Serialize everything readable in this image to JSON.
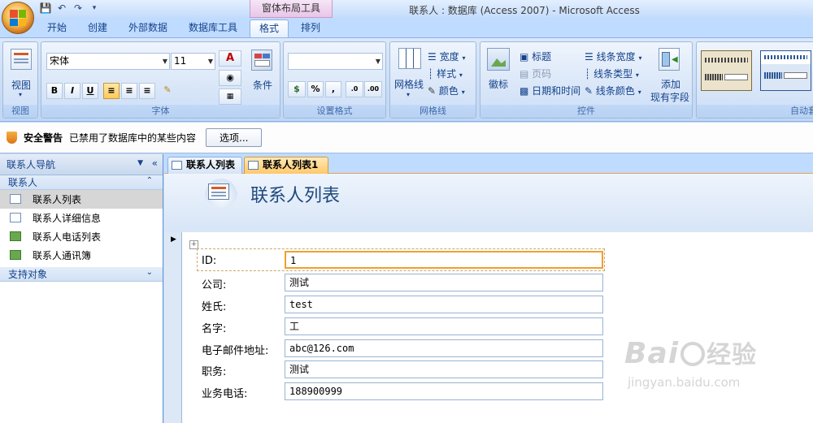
{
  "window": {
    "title": "联系人 : 数据库 (Access 2007) - Microsoft Access",
    "context_tools": "窗体布局工具"
  },
  "tabs": [
    "开始",
    "创建",
    "外部数据",
    "数据库工具",
    "格式",
    "排列"
  ],
  "ribbon": {
    "view": {
      "label": "视图",
      "group": "视图"
    },
    "font": {
      "family": "宋体",
      "size": "11",
      "conditions": "条件",
      "group": "字体"
    },
    "format": {
      "group": "设置格式"
    },
    "gridlines": {
      "label": "网格线",
      "width": "宽度",
      "style": "样式",
      "color": "颜色",
      "group": "网格线"
    },
    "controls": {
      "logo": "徽标",
      "title": "标题",
      "page": "页码",
      "datetime": "日期和时间",
      "line_width": "线条宽度",
      "line_type": "线条类型",
      "line_color": "线条颜色",
      "add_field": "添加",
      "add_field2": "现有字段",
      "group": "控件"
    },
    "autoformat": {
      "group": "自动套"
    }
  },
  "security": {
    "title": "安全警告",
    "message": "已禁用了数据库中的某些内容",
    "options_button": "选项..."
  },
  "nav": {
    "header": "联系人导航",
    "section1": "联系人",
    "items": [
      "联系人列表",
      "联系人详细信息",
      "联系人电话列表",
      "联系人通讯簿"
    ],
    "section2": "支持对象"
  },
  "doc_tabs": [
    "联系人列表",
    "联系人列表1"
  ],
  "form": {
    "title": "联系人列表",
    "fields": [
      {
        "label": "ID:",
        "value": "1"
      },
      {
        "label": "公司:",
        "value": "测试"
      },
      {
        "label": "姓氏:",
        "value": "test"
      },
      {
        "label": "名字:",
        "value": "工"
      },
      {
        "label": "电子邮件地址:",
        "value": "abc@126.com"
      },
      {
        "label": "职务:",
        "value": "测试"
      },
      {
        "label": "业务电话:",
        "value": "188900999"
      }
    ]
  },
  "watermark": {
    "brand": "Bai",
    "brand2": "经验",
    "url": "jingyan.baidu.com"
  }
}
